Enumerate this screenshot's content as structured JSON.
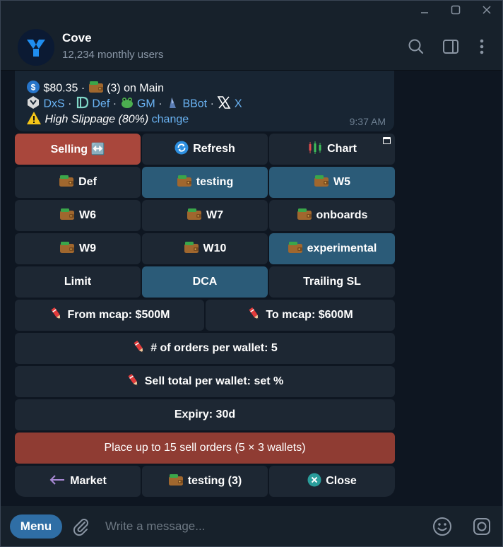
{
  "window": {
    "minimize_icon": "minimize-icon",
    "maximize_icon": "maximize-icon",
    "close_icon": "close-icon"
  },
  "header": {
    "title": "Cove",
    "subtitle": "12,234 monthly users",
    "icons": [
      "search-icon",
      "sidebar-toggle-icon",
      "more-vertical-icon"
    ]
  },
  "message": {
    "balance": "$80.35",
    "sep1": " · ",
    "wallet_count": "(3) on Main",
    "links": [
      "DxS",
      "Def",
      "GM",
      "BBot",
      "X"
    ],
    "warning_text": "High Slippage (80%)",
    "warning_link": "change",
    "time": "9:37 AM"
  },
  "keyboard": {
    "row1": [
      "Selling ↔️",
      "Refresh",
      "Chart"
    ],
    "row2": [
      "Def",
      "testing",
      "W5"
    ],
    "row3": [
      "W6",
      "W7",
      "onboards"
    ],
    "row4": [
      "W9",
      "W10",
      "experimental"
    ],
    "row5": [
      "Limit",
      "DCA",
      "Trailing SL"
    ],
    "row6": [
      "From mcap: $500M",
      "To mcap: $600M"
    ],
    "row7": "# of orders per wallet: 5",
    "row8": "Sell total per wallet: set %",
    "row9": "Expiry: 30d",
    "row10": "Place up to 15 sell orders (5 × 3 wallets)",
    "row11": [
      "Market",
      "testing (3)",
      "Close"
    ]
  },
  "input": {
    "menu_label": "Menu",
    "placeholder": "Write a message..."
  },
  "colors": {
    "background": "#0e1621",
    "panel": "#17212b",
    "bubble": "#182533",
    "button": "#1d2733",
    "button_selected": "#2b5b78",
    "button_red": "#a9473c",
    "link": "#6ab3f3",
    "menu_button": "#2f6ea5"
  }
}
